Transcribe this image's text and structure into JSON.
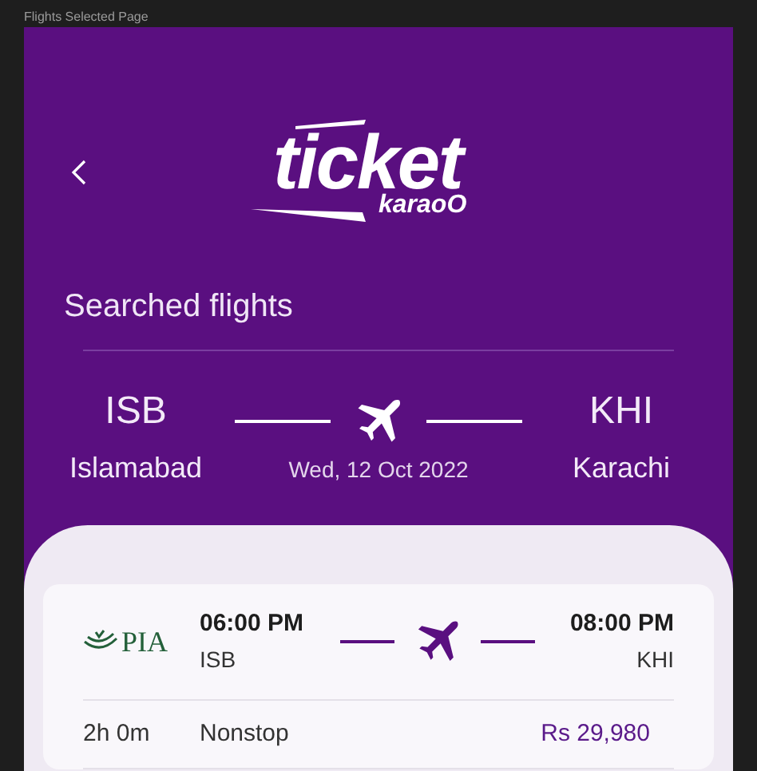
{
  "frame_label": "Flights Selected Page",
  "logo": {
    "word": "ticket",
    "sub": "karaoO"
  },
  "heading": "Searched flights",
  "route": {
    "from_code": "ISB",
    "from_city": "Islamabad",
    "to_code": "KHI",
    "to_city": "Karachi",
    "date": "Wed, 12 Oct 2022"
  },
  "flights": [
    {
      "airline": "PIA",
      "depart_time": "06:00 PM",
      "depart_code": "ISB",
      "arrive_time": "08:00 PM",
      "arrive_code": "KHI",
      "duration": "2h 0m",
      "stops": "Nonstop",
      "price": "Rs 29,980"
    }
  ]
}
